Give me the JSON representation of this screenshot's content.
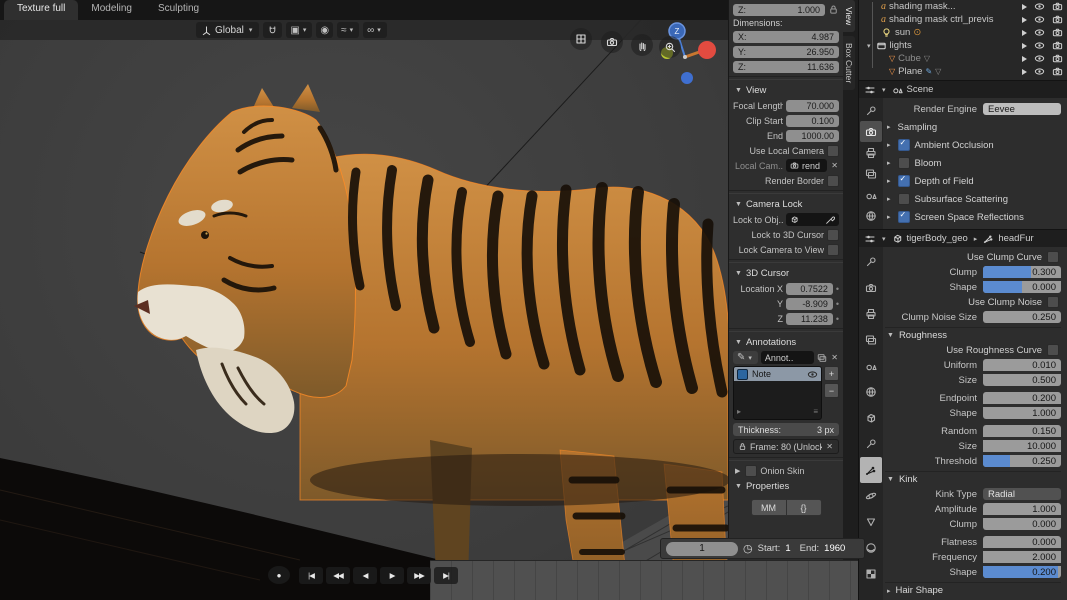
{
  "workspace": {
    "tabs": [
      {
        "label": "Texture full"
      },
      {
        "label": "Modeling"
      },
      {
        "label": "Sculpting"
      }
    ]
  },
  "viewport": {
    "orientation": "Global",
    "gizmo_axis": "Z"
  },
  "npanel": {
    "tabs": [
      {
        "label": "View"
      },
      {
        "label": "Box Cutter"
      }
    ],
    "transform": {
      "z_label": "Z:",
      "z_value": "1.000",
      "dimensions_label": "Dimensions:",
      "dims": [
        {
          "label": "X:",
          "value": "4.987"
        },
        {
          "label": "Y:",
          "value": "26.950"
        },
        {
          "label": "Z:",
          "value": "11.636"
        }
      ]
    },
    "view": {
      "title": "View",
      "rows": [
        {
          "label": "Focal Length",
          "value": "70.000"
        },
        {
          "label": "Clip Start",
          "value": "0.100"
        },
        {
          "label": "End",
          "value": "1000.00"
        }
      ],
      "use_local_camera": "Use Local Camera",
      "local_camera_label": "Local Cam..",
      "local_camera_value": "rend",
      "render_border": "Render Border"
    },
    "camera_lock": {
      "title": "Camera Lock",
      "lock_object_label": "Lock to Obj..",
      "lock_cursor_label": "Lock to 3D Cursor",
      "lock_view_label": "Lock Camera to View"
    },
    "cursor3d": {
      "title": "3D Cursor",
      "rows": [
        {
          "label": "Location X",
          "value": "0.7522"
        },
        {
          "label": "Y",
          "value": "-8.909"
        },
        {
          "label": "Z",
          "value": "11.238"
        }
      ]
    },
    "annotations": {
      "title": "Annotations",
      "layer_field": "Annot..",
      "note_label": "Note",
      "thickness_label": "Thickness:",
      "thickness_value": "3 px",
      "frame_label": "Frame: 80 (Unlock..",
      "add_label": "+",
      "remove_label": "−"
    },
    "onion_skin": "Onion Skin",
    "properties": {
      "title": "Properties",
      "button_mm": "MM",
      "button_braces": "{}"
    }
  },
  "outliner": {
    "items": [
      {
        "name": "shading mask..."
      },
      {
        "name": "shading mask ctrl_previs"
      },
      {
        "name": "sun"
      },
      {
        "name": "lights"
      },
      {
        "name": "Cube"
      },
      {
        "name": "Plane"
      }
    ]
  },
  "render_props": {
    "breadcrumb": "Scene",
    "engine_label": "Render Engine",
    "engine_value": "Eevee",
    "sections": [
      {
        "label": "Sampling",
        "checkbox": "none"
      },
      {
        "label": "Ambient Occlusion",
        "checkbox": "checked"
      },
      {
        "label": "Bloom",
        "checkbox": "unchecked"
      },
      {
        "label": "Depth of Field",
        "checkbox": "checked"
      },
      {
        "label": "Subsurface Scattering",
        "checkbox": "unchecked"
      },
      {
        "label": "Screen Space Reflections",
        "checkbox": "checked"
      }
    ]
  },
  "particle_props": {
    "object_name": "tigerBody_geo",
    "system_name": "headFur",
    "use_clump_curve": "Use Clump Curve",
    "clump_rows": [
      {
        "label": "Clump",
        "value": "0.300"
      },
      {
        "label": "Shape",
        "value": "0.000"
      }
    ],
    "use_clump_noise": "Use Clump Noise",
    "clump_noise": {
      "label": "Clump Noise Size",
      "value": "0.250"
    },
    "roughness": {
      "title": "Roughness",
      "use_curve": "Use Roughness Curve",
      "rows": [
        {
          "label": "Uniform",
          "value": "0.010"
        },
        {
          "label": "Size",
          "value": "0.500"
        },
        {
          "label": "Endpoint",
          "value": "0.200"
        },
        {
          "label": "Shape",
          "value": "1.000"
        },
        {
          "label": "Random",
          "value": "0.150"
        },
        {
          "label": "Size",
          "value": "10.000"
        },
        {
          "label": "Threshold",
          "value": "0.250"
        }
      ]
    },
    "kink": {
      "title": "Kink",
      "type_label": "Kink Type",
      "type_value": "Radial",
      "rows": [
        {
          "label": "Amplitude",
          "value": "1.000"
        },
        {
          "label": "Clump",
          "value": "0.000"
        },
        {
          "label": "Flatness",
          "value": "0.000"
        },
        {
          "label": "Frequency",
          "value": "2.000"
        },
        {
          "label": "Shape",
          "value": "0.200"
        }
      ]
    },
    "hair_shape_title": "Hair Shape"
  },
  "timeline": {
    "current_frame": "1",
    "start_label": "Start:",
    "start_value": "1",
    "end_label": "End:",
    "end_value": "1960",
    "controls": [
      {
        "name": "record",
        "glyph": "●"
      },
      {
        "name": "jump-to-start",
        "glyph": "|◀"
      },
      {
        "name": "prev-keyframe",
        "glyph": "◀◀"
      },
      {
        "name": "play-reverse",
        "glyph": "◀"
      },
      {
        "name": "play",
        "glyph": "▶"
      },
      {
        "name": "next-keyframe",
        "glyph": "▶▶"
      },
      {
        "name": "jump-to-end",
        "glyph": "▶|"
      }
    ]
  },
  "colors": {
    "accent": "#5b8bd0",
    "checkbox_blue": "#4470b0",
    "selection_outline": "#ff8c26"
  }
}
